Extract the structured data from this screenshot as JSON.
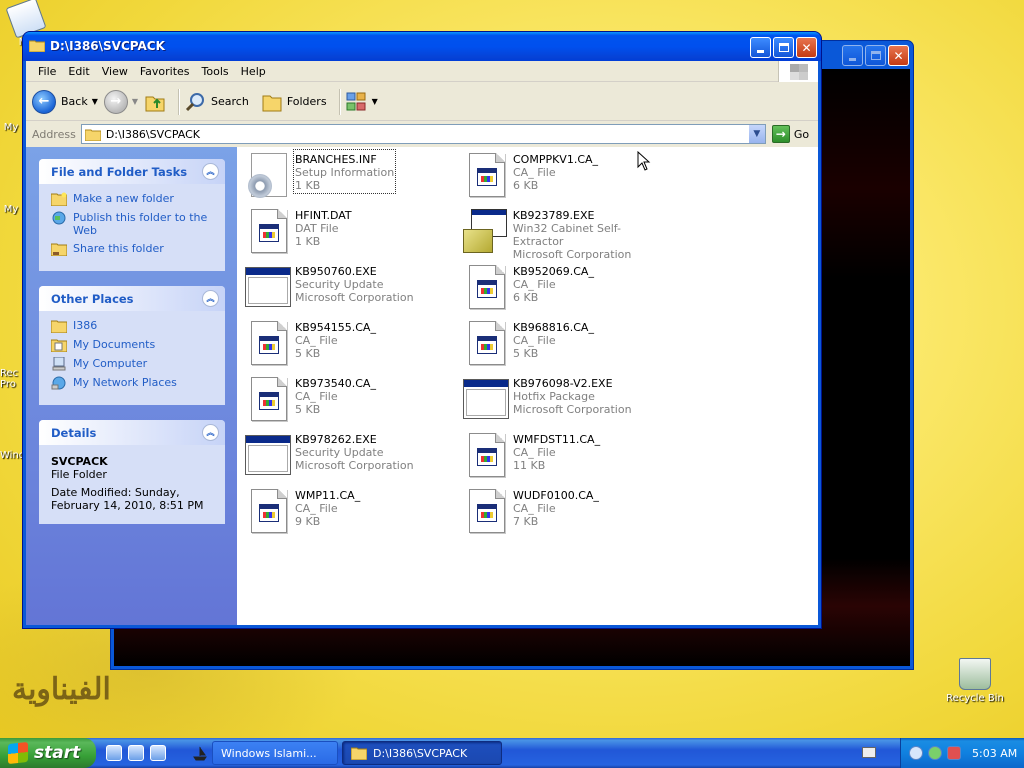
{
  "desktop": {
    "icons": [
      {
        "label": "My",
        "id": "my-documents"
      },
      {
        "label": "My",
        "id": "my-computer"
      },
      {
        "label": "My",
        "id": "my-network"
      },
      {
        "label": "Rec Pro",
        "id": "recycle-partial"
      },
      {
        "label": "Windo",
        "id": "windows-partial"
      },
      {
        "label": "Recycle Bin",
        "id": "recycle-bin"
      }
    ],
    "decoration_text": "الفيناوية"
  },
  "window": {
    "title": "D:\\I386\\SVCPACK",
    "menu": [
      "File",
      "Edit",
      "View",
      "Favorites",
      "Tools",
      "Help"
    ],
    "toolbar": {
      "back": "Back",
      "search": "Search",
      "folders": "Folders"
    },
    "address": {
      "label": "Address",
      "value": "D:\\I386\\SVCPACK",
      "go": "Go"
    },
    "taskpane": {
      "file_tasks": {
        "title": "File and Folder Tasks",
        "links": [
          "Make a new folder",
          "Publish this folder to the Web",
          "Share this folder"
        ]
      },
      "other_places": {
        "title": "Other Places",
        "links": [
          "I386",
          "My Documents",
          "My Computer",
          "My Network Places"
        ]
      },
      "details": {
        "title": "Details",
        "name": "SVCPACK",
        "type": "File Folder",
        "modified": "Date Modified: Sunday, February 14, 2010, 8:51 PM"
      }
    },
    "files": [
      {
        "name": "BRANCHES.INF",
        "line2": "Setup Information",
        "line3": "1 KB",
        "icon": "setup-info-icon"
      },
      {
        "name": "COMPPKV1.CA_",
        "line2": "CA_ File",
        "line3": "6 KB",
        "icon": "ca-file-icon"
      },
      {
        "name": "HFINT.DAT",
        "line2": "DAT File",
        "line3": "1 KB",
        "icon": "dat-file-icon"
      },
      {
        "name": "KB923789.EXE",
        "line2": "Win32 Cabinet Self-Extractor",
        "line3": "Microsoft Corporation",
        "icon": "cabinet-extractor-icon"
      },
      {
        "name": "KB950760.EXE",
        "line2": "Security Update",
        "line3": "Microsoft Corporation",
        "icon": "exe-window-icon"
      },
      {
        "name": "KB952069.CA_",
        "line2": "CA_ File",
        "line3": "6 KB",
        "icon": "ca-file-icon"
      },
      {
        "name": "KB954155.CA_",
        "line2": "CA_ File",
        "line3": "5 KB",
        "icon": "ca-file-icon"
      },
      {
        "name": "KB968816.CA_",
        "line2": "CA_ File",
        "line3": "5 KB",
        "icon": "ca-file-icon"
      },
      {
        "name": "KB973540.CA_",
        "line2": "CA_ File",
        "line3": "5 KB",
        "icon": "ca-file-icon"
      },
      {
        "name": "KB976098-V2.EXE",
        "line2": "Hotfix Package",
        "line3": "Microsoft Corporation",
        "icon": "exe-window-icon"
      },
      {
        "name": "KB978262.EXE",
        "line2": "Security Update",
        "line3": "Microsoft Corporation",
        "icon": "exe-window-icon"
      },
      {
        "name": "WMFDST11.CA_",
        "line2": "CA_ File",
        "line3": "11 KB",
        "icon": "ca-file-icon"
      },
      {
        "name": "WMP11.CA_",
        "line2": "CA_ File",
        "line3": "9 KB",
        "icon": "ca-file-icon"
      },
      {
        "name": "WUDF0100.CA_",
        "line2": "CA_ File",
        "line3": "7 KB",
        "icon": "ca-file-icon"
      }
    ]
  },
  "taskbar": {
    "start": "start",
    "tasks": [
      {
        "label": "Windows Islami...",
        "active": false
      },
      {
        "label": "D:\\I386\\SVCPACK",
        "active": true
      }
    ],
    "clock": "5:03 AM"
  },
  "colors": {
    "xp_blue": "#0a58d8",
    "taskpane_link": "#215dc6",
    "start_green": "#37a037"
  }
}
